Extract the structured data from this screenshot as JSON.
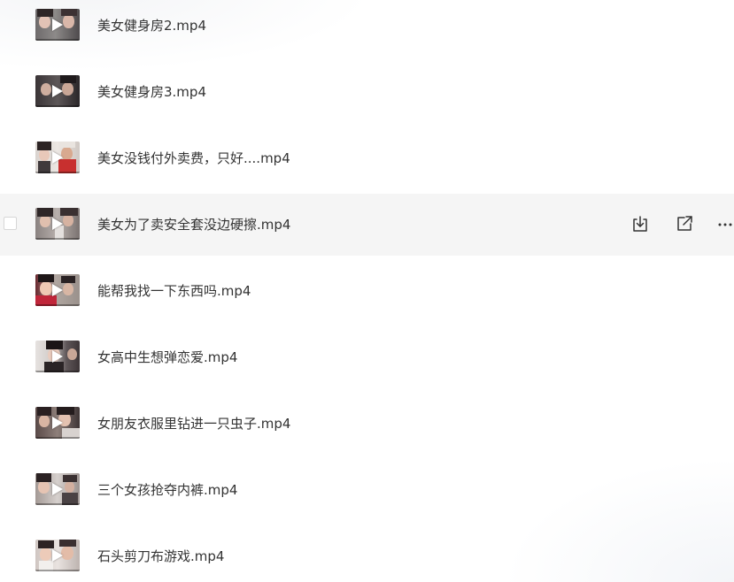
{
  "files": [
    {
      "name": "美女健身房2.mp4"
    },
    {
      "name": "美女健身房3.mp4"
    },
    {
      "name": "美女没钱付外卖费，只好....mp4"
    },
    {
      "name": "美女为了卖安全套没边硬擦.mp4"
    },
    {
      "name": "能帮我找一下东西吗.mp4"
    },
    {
      "name": "女高中生想弹恋爱.mp4"
    },
    {
      "name": "女朋友衣服里钻进一只虫子.mp4"
    },
    {
      "name": "三个女孩抢夺内裤.mp4"
    },
    {
      "name": "石头剪刀布游戏.mp4"
    }
  ],
  "hovered_row": {
    "index": 3,
    "actions": [
      {
        "icon": "download-icon"
      },
      {
        "icon": "share-icon"
      },
      {
        "icon": "more-icon"
      }
    ]
  },
  "colors": {
    "text": "#333333",
    "row_hover_background": "#f5f5f5",
    "icon_stroke": "#333333"
  }
}
